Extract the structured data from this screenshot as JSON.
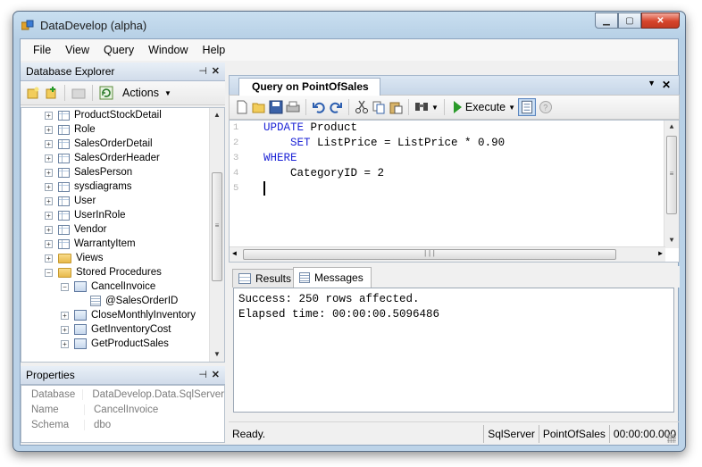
{
  "window": {
    "title": "DataDevelop (alpha)",
    "controls": [
      "minimize-icon",
      "maximize-icon",
      "close-icon"
    ]
  },
  "menu": [
    "File",
    "View",
    "Query",
    "Window",
    "Help"
  ],
  "explorer": {
    "title": "Database Explorer",
    "toolbar": {
      "actions_label": "Actions"
    },
    "tree": [
      {
        "label": "ProductStockDetail",
        "type": "table",
        "level": 1,
        "expander": "+"
      },
      {
        "label": "Role",
        "type": "table",
        "level": 1,
        "expander": "+"
      },
      {
        "label": "SalesOrderDetail",
        "type": "table",
        "level": 1,
        "expander": "+"
      },
      {
        "label": "SalesOrderHeader",
        "type": "table",
        "level": 1,
        "expander": "+"
      },
      {
        "label": "SalesPerson",
        "type": "table",
        "level": 1,
        "expander": "+"
      },
      {
        "label": "sysdiagrams",
        "type": "table",
        "level": 1,
        "expander": "+"
      },
      {
        "label": "User",
        "type": "table",
        "level": 1,
        "expander": "+"
      },
      {
        "label": "UserInRole",
        "type": "table",
        "level": 1,
        "expander": "+"
      },
      {
        "label": "Vendor",
        "type": "table",
        "level": 1,
        "expander": "+"
      },
      {
        "label": "WarrantyItem",
        "type": "table",
        "level": 1,
        "expander": "+"
      },
      {
        "label": "Views",
        "type": "folder",
        "level": 1,
        "expander": "+"
      },
      {
        "label": "Stored Procedures",
        "type": "folder",
        "level": 1,
        "expander": "-"
      },
      {
        "label": "CancelInvoice",
        "type": "procedure",
        "level": 2,
        "expander": "-"
      },
      {
        "label": "@SalesOrderID",
        "type": "parameter",
        "level": 3,
        "expander": ""
      },
      {
        "label": "CloseMonthlyInventory",
        "type": "procedure",
        "level": 2,
        "expander": "+"
      },
      {
        "label": "GetInventoryCost",
        "type": "procedure",
        "level": 2,
        "expander": "+"
      },
      {
        "label": "GetProductSales",
        "type": "procedure",
        "level": 2,
        "expander": "+"
      }
    ]
  },
  "properties": {
    "title": "Properties",
    "rows": [
      {
        "key": "Database",
        "value": "DataDevelop.Data.SqlServer"
      },
      {
        "key": "Name",
        "value": "CancelInvoice"
      },
      {
        "key": "Schema",
        "value": "dbo"
      }
    ]
  },
  "document": {
    "tab_label": "Query on PointOfSales",
    "toolbar": {
      "execute_label": "Execute"
    },
    "editor": {
      "line_numbers": [
        "1",
        "2",
        "3",
        "4",
        "5"
      ],
      "lines": [
        {
          "indent": "",
          "kw": "UPDATE",
          "rest": " Product"
        },
        {
          "indent": "    ",
          "kw": "SET",
          "rest": " ListPrice = ListPrice * 0.90"
        },
        {
          "indent": "",
          "kw": "WHERE",
          "rest": ""
        },
        {
          "indent": "    ",
          "kw": "",
          "rest": "CategoryID = 2"
        },
        {
          "indent": "",
          "kw": "",
          "rest": ""
        }
      ]
    },
    "result_tabs": [
      "Results",
      "Messages"
    ],
    "messages": [
      "Success: 250 rows affected.",
      "Elapsed time: 00:00:00.5096486"
    ]
  },
  "status": {
    "text": "Ready.",
    "provider": "SqlServer",
    "database": "PointOfSales",
    "elapsed": "00:00:00.000"
  },
  "colors": {
    "keyword": "#1d24d6",
    "execute_green": "#2a9a2a",
    "close_red": "#d6442b"
  }
}
